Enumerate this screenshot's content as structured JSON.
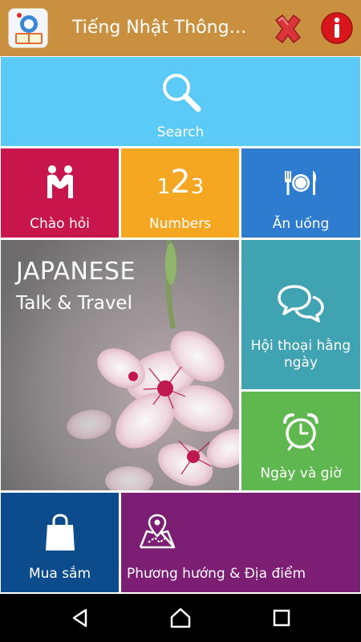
{
  "app": {
    "title": "Tiếng Nhật Thông…",
    "icon": "app-logo-icon",
    "close_icon": "close-icon",
    "info_icon": "info-icon"
  },
  "tiles": {
    "search": {
      "label": "Search",
      "icon": "search-icon",
      "color": "#5ccaf6"
    },
    "greetings": {
      "label": "Chào hỏi",
      "icon": "people-icon",
      "color": "#c8154b"
    },
    "numbers": {
      "label": "Numbers",
      "icon": "numbers-icon",
      "glyph_1": "1",
      "glyph_2": "2",
      "glyph_3": "3",
      "color": "#f6a721"
    },
    "eating": {
      "label": "Ăn uống",
      "icon": "dining-icon",
      "color": "#2e7cd0"
    },
    "hero": {
      "title": "JAPANESE",
      "subtitle": "Talk & Travel",
      "image": "cherry-blossom-image"
    },
    "conversation": {
      "label_line1": "Hội thoại hằng",
      "label_line2": "ngày",
      "icon": "chat-bubbles-icon",
      "color": "#40a3b1"
    },
    "datetime": {
      "label": "Ngày và giờ",
      "icon": "alarm-clock-icon",
      "color": "#5fb74f"
    },
    "shopping": {
      "label": "Mua sắm",
      "icon": "shopping-bag-icon",
      "color": "#0c4c8d"
    },
    "directions": {
      "label": "Phương hướng & Địa điểm",
      "icon": "map-pin-icon",
      "color": "#7c1e73"
    }
  },
  "navbar": {
    "back": "back-icon",
    "home": "home-icon",
    "recents": "recents-icon"
  }
}
